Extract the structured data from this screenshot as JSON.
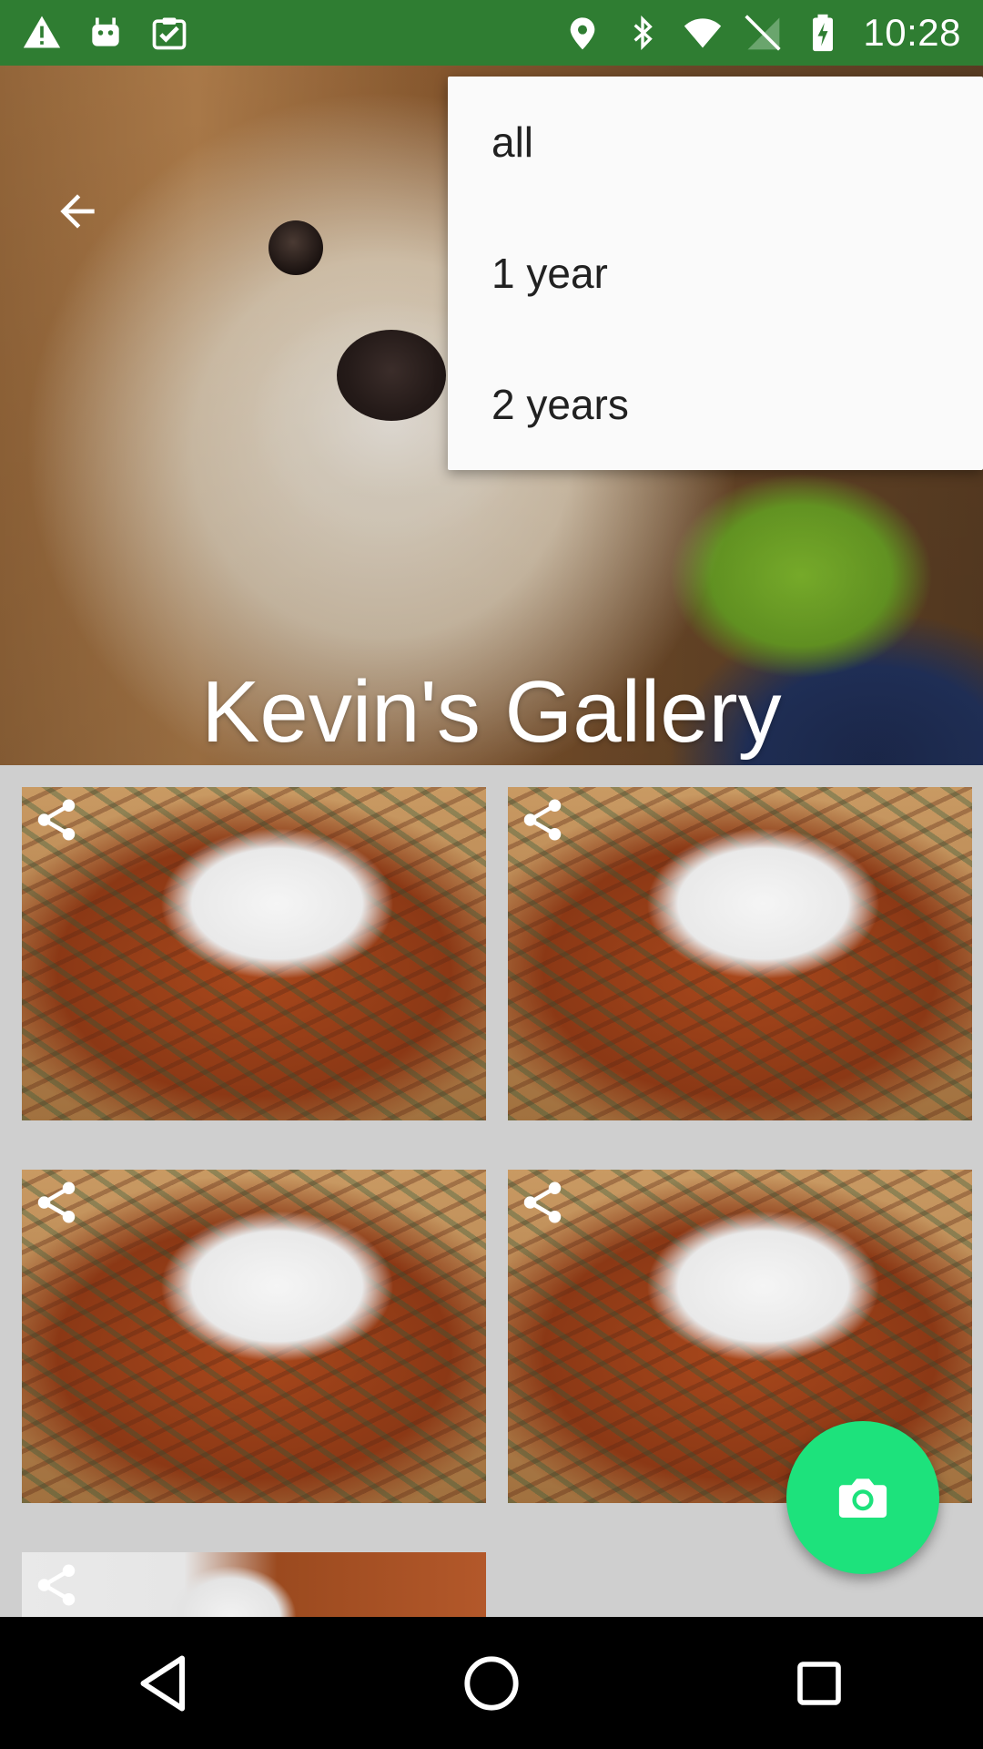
{
  "status_bar": {
    "time": "10:28",
    "icons_left": [
      "warning-icon",
      "android-icon",
      "clipboard-check-icon"
    ],
    "icons_right": [
      "location-icon",
      "bluetooth-icon",
      "wifi-icon",
      "no-sim-icon",
      "battery-charging-icon"
    ]
  },
  "header": {
    "title": "Kevin's Gallery",
    "back_icon": "arrow-back-icon"
  },
  "menu": {
    "items": [
      {
        "label": "all"
      },
      {
        "label": "1 year"
      },
      {
        "label": "2 years"
      }
    ]
  },
  "gallery": {
    "tiles": [
      {
        "share_icon": "share-icon"
      },
      {
        "share_icon": "share-icon"
      },
      {
        "share_icon": "share-icon"
      },
      {
        "share_icon": "share-icon"
      },
      {
        "share_icon": "share-icon"
      }
    ]
  },
  "fab": {
    "icon": "camera-icon",
    "color": "#1de27c"
  },
  "colors": {
    "status_bar": "#2f7d32",
    "menu_background": "#fafafa",
    "grid_background": "#cfcfcf"
  },
  "nav_bar": {
    "icons": [
      "back-triangle-icon",
      "home-circle-icon",
      "recents-square-icon"
    ]
  }
}
